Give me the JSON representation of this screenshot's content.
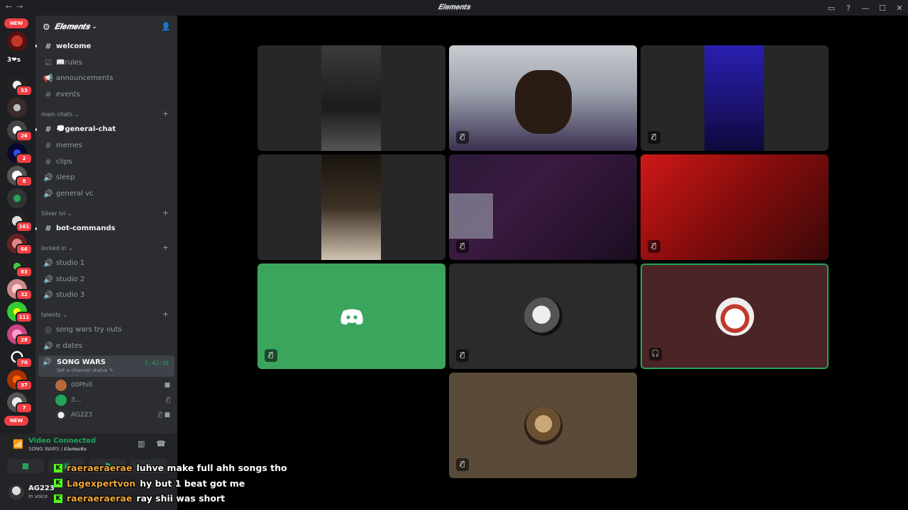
{
  "window": {
    "title": "𝑬𝒍𝒆𝒎𝒆𝒏𝒕𝒔",
    "nav": "←→",
    "controls": [
      "▭",
      "?",
      "—",
      "☐",
      "✕"
    ]
  },
  "guilds": {
    "top_badge": "NEW",
    "items": [
      {
        "badge": ""
      },
      {
        "text": "3❤s"
      },
      {
        "badge": "53"
      },
      {
        "badge": ""
      },
      {
        "badge": "26"
      },
      {
        "badge": "2"
      },
      {
        "badge": "8"
      },
      {
        "badge": ""
      },
      {
        "badge": "161"
      },
      {
        "badge": "66"
      },
      {
        "badge": "83"
      },
      {
        "badge": "32"
      },
      {
        "badge": "111"
      },
      {
        "badge": "28"
      },
      {
        "badge": "70"
      },
      {
        "badge": "37"
      },
      {
        "badge": "7"
      }
    ],
    "bottom_badge": "NEW"
  },
  "server": {
    "name": "𝑬𝒍𝒆𝒎𝒆𝒏𝒕𝒔",
    "caret": "⌄"
  },
  "channels": {
    "top": [
      {
        "icon": "#",
        "label": "welcome",
        "unread": true
      },
      {
        "icon": "☑",
        "label": "📖rules",
        "unread": false
      },
      {
        "icon": "📢",
        "label": "announcements",
        "unread": false
      },
      {
        "icon": "#",
        "label": "events",
        "unread": false
      }
    ],
    "categories": [
      {
        "name": "main chats",
        "items": [
          {
            "icon": "#",
            "label": "💭general-chat",
            "unread": true
          },
          {
            "icon": "#",
            "label": "memes",
            "unread": false
          },
          {
            "icon": "#",
            "label": "clips",
            "unread": false
          },
          {
            "icon": "🔊",
            "label": "sleep",
            "unread": false
          },
          {
            "icon": "🔊",
            "label": "general vc",
            "unread": false
          }
        ]
      },
      {
        "name": "Silver lvl",
        "items": [
          {
            "icon": "#",
            "label": "bot-commands",
            "unread": true
          }
        ]
      },
      {
        "name": "locked in",
        "items": [
          {
            "icon": "🔊",
            "label": "studio 1",
            "unread": false
          },
          {
            "icon": "🔊",
            "label": "studio 2",
            "unread": false
          },
          {
            "icon": "🔊",
            "label": "studio 3",
            "unread": false
          }
        ]
      },
      {
        "name": "talents",
        "items": [
          {
            "icon": "◎",
            "label": "song wars try outs",
            "unread": false
          },
          {
            "icon": "🔊",
            "label": "e dates",
            "unread": false
          }
        ]
      }
    ],
    "active_voice": {
      "name": "SONG WARS",
      "timer": "1:42:16",
      "status": "Set a channel status ✎"
    },
    "voice_users": [
      {
        "name": "00Phill",
        "right": "■",
        "color": "#b66a3c"
      },
      {
        "name": "3...",
        "right": "🎙̸",
        "color": "#23a55a"
      },
      {
        "name": "AG223",
        "right": "🎙̸ ■",
        "color": "#ddd"
      }
    ]
  },
  "voice_panel": {
    "status": "Video Connected",
    "location": "SONG WARS / 𝑬𝒍𝒆𝒎𝒆𝒏𝒕𝒔",
    "buttons": [
      "■",
      "▣",
      "⚑",
      "✦"
    ]
  },
  "user_panel": {
    "name": "AG223",
    "status": "In voice"
  },
  "tiles": [
    {
      "muted": "🎙̸",
      "kind": "cam1"
    },
    {
      "muted": "🎙̸",
      "kind": "cam2"
    },
    {
      "muted": "🎙̸",
      "kind": "cam3"
    },
    {
      "muted": "",
      "kind": "cam4"
    },
    {
      "muted": "🎙̸",
      "kind": "cam5"
    },
    {
      "muted": "🎙̸",
      "kind": "cam6"
    },
    {
      "muted": "🎙̸",
      "kind": "discord",
      "color": "#3ba55d"
    },
    {
      "muted": "🎙̸",
      "kind": "avatar",
      "color": "#2b2b2b"
    },
    {
      "muted": "🎧",
      "kind": "avatar",
      "color": "#4a2426",
      "speaking": true
    },
    {
      "muted": "🎙̸",
      "kind": "avatar",
      "color": "#5a4a38"
    }
  ],
  "chat": [
    {
      "user": "raeraeraerae",
      "message": "luhve make full ahh songs tho"
    },
    {
      "user": "Lagexpertvon",
      "message": "hy but 1 beat got me"
    },
    {
      "user": "raeraeraerae",
      "message": "ray shii was short"
    }
  ],
  "chat_badge": "K"
}
